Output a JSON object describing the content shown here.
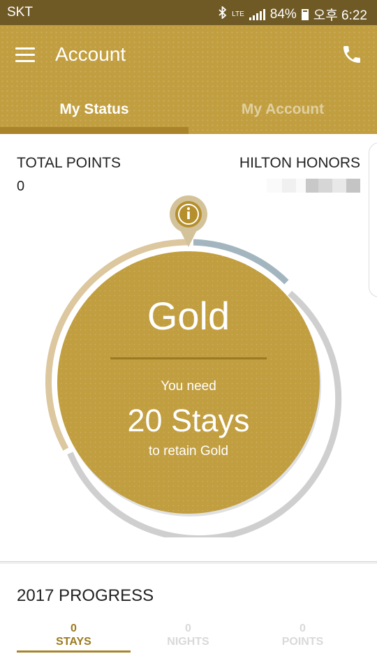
{
  "status_bar": {
    "carrier": "SKT",
    "icons": [
      "bluetooth-icon",
      "lte-icon",
      "signal-icon",
      "battery-icon"
    ],
    "lte_label": "LTE",
    "battery_percent": "84%",
    "time": "오후 6:22"
  },
  "app_bar": {
    "title": "Account",
    "menu_icon": "hamburger-menu-icon",
    "call_icon": "phone-icon"
  },
  "tabs": [
    {
      "label": "My Status",
      "selected": true
    },
    {
      "label": "My Account",
      "selected": false
    }
  ],
  "points": {
    "label": "TOTAL POINTS",
    "value": "0"
  },
  "membership": {
    "label": "HILTON HONORS"
  },
  "status_circle": {
    "info_icon": "info-icon",
    "level": "Gold",
    "need_text": "You need",
    "requirement": "20 Stays",
    "retain_text": "to retain Gold"
  },
  "colors": {
    "gold": "#c19e3f",
    "dark_gold": "#a9842b",
    "status_bar": "#6f5a26",
    "ring_tan": "#dcc79e",
    "ring_blue": "#a3b6bf",
    "ring_grey": "#cfcfcf"
  },
  "progress": {
    "title": "2017 PROGRESS",
    "tabs": [
      {
        "value": "0",
        "label": "STAYS",
        "selected": true
      },
      {
        "value": "0",
        "label": "NIGHTS",
        "selected": false
      },
      {
        "value": "0",
        "label": "POINTS",
        "selected": false
      }
    ]
  }
}
